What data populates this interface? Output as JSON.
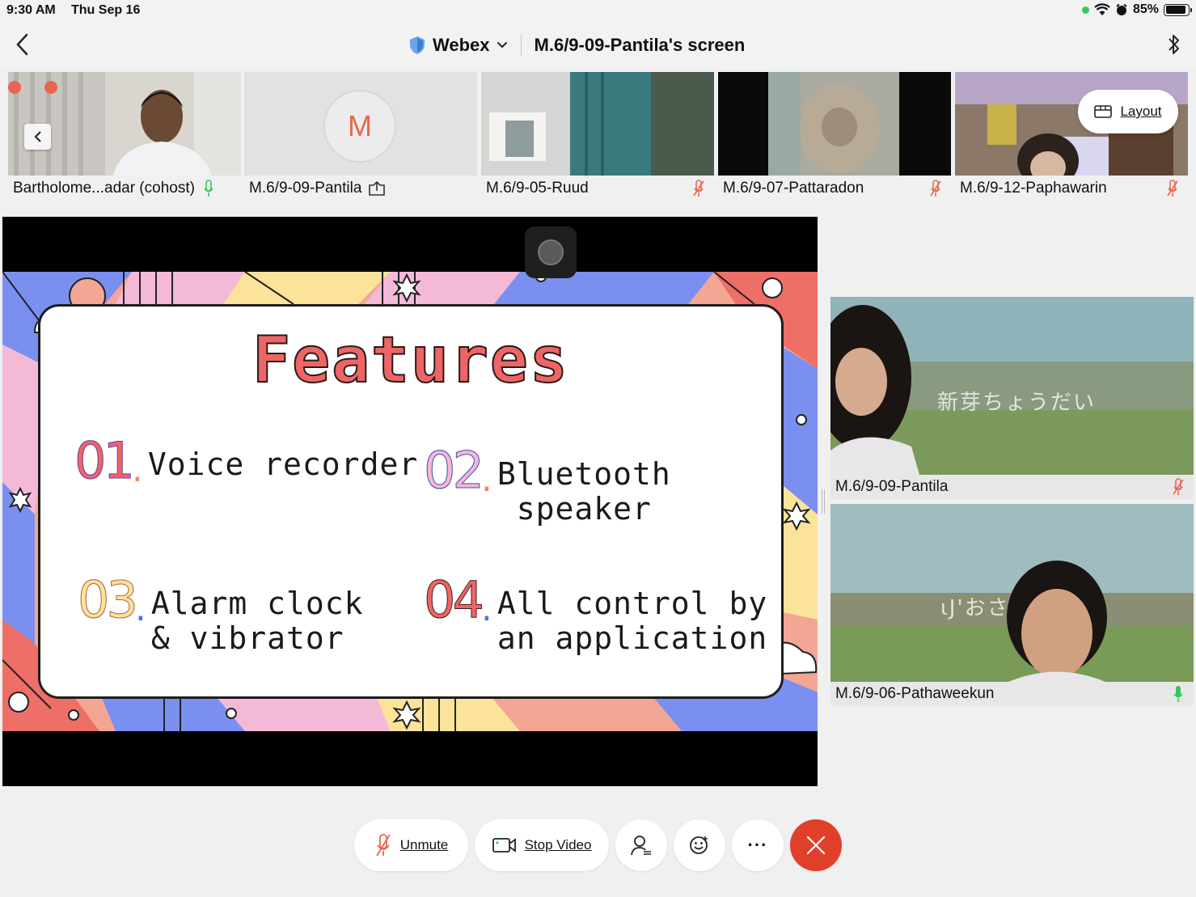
{
  "status_bar": {
    "time": "9:30 AM",
    "date": "Thu Sep 16",
    "battery": "85%"
  },
  "header": {
    "app_name": "Webex",
    "screen_title": "M.6/9-09-Pantila's screen"
  },
  "participants_strip": [
    {
      "name": "Bartholome...adar (cohost)",
      "mic": "on"
    },
    {
      "name": "M.6/9-09-Pantila",
      "avatar_letter": "M",
      "sharing": true
    },
    {
      "name": "M.6/9-05-Ruud",
      "mic": "muted"
    },
    {
      "name": "M.6/9-07-Pattaradon",
      "mic": "muted"
    },
    {
      "name": "M.6/9-12-Paphawarin",
      "mic": "muted"
    }
  ],
  "layout_button": {
    "label": "Layout"
  },
  "slide": {
    "title": "Features",
    "items": [
      {
        "num": "01",
        "text": "Voice recorder"
      },
      {
        "num": "02",
        "text": "Bluetooth\n speaker"
      },
      {
        "num": "03",
        "text": "Alarm clock\n& vibrator"
      },
      {
        "num": "04",
        "text": "All control by\nan application"
      }
    ]
  },
  "side_videos": [
    {
      "name": "M.6/9-09-Pantila",
      "mic": "muted",
      "background_text": "新芽ちょうだい"
    },
    {
      "name": "M.6/9-06-Pathaweekun",
      "mic": "on",
      "background_text": "ιJ'おさ"
    }
  ],
  "controls": {
    "unmute_label": "Unmute",
    "stop_video_label": "Stop Video",
    "more_label": "···"
  },
  "colors": {
    "accent_red": "#e0402a",
    "mic_green": "#34c759",
    "muted_red": "#e8664f",
    "slide_title": "#ee6565"
  }
}
